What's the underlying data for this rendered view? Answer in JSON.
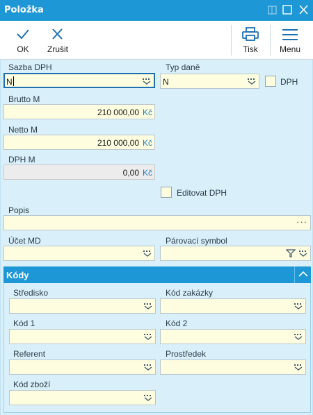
{
  "window": {
    "title": "Položka"
  },
  "toolbar": {
    "ok": "OK",
    "cancel": "Zrušit",
    "print": "Tisk",
    "menu": "Menu"
  },
  "fields": {
    "sazba_dph": {
      "label": "Sazba DPH",
      "value": "N"
    },
    "typ_dane": {
      "label": "Typ daně",
      "value": "N"
    },
    "dph_check": {
      "label": "DPH",
      "checked": false
    },
    "brutto": {
      "label": "Brutto M",
      "value": "210 000,00",
      "currency": "Kč"
    },
    "netto": {
      "label": "Netto M",
      "value": "210 000,00",
      "currency": "Kč"
    },
    "dph_m": {
      "label": "DPH M",
      "value": "0,00",
      "currency": "Kč"
    },
    "editovat_dph": {
      "label": "Editovat DPH",
      "checked": false
    },
    "popis": {
      "label": "Popis",
      "value": ""
    },
    "ucet_md": {
      "label": "Účet MD",
      "value": ""
    },
    "parovaci_symbol": {
      "label": "Párovací symbol",
      "value": ""
    }
  },
  "kody": {
    "title": "Kódy",
    "stredisko": {
      "label": "Středisko",
      "value": ""
    },
    "kod_zakazky": {
      "label": "Kód zakázky",
      "value": ""
    },
    "kod1": {
      "label": "Kód 1",
      "value": ""
    },
    "kod2": {
      "label": "Kód 2",
      "value": ""
    },
    "referent": {
      "label": "Referent",
      "value": ""
    },
    "prostredek": {
      "label": "Prostředek",
      "value": ""
    },
    "kod_zbozi": {
      "label": "Kód zboží",
      "value": ""
    }
  },
  "colors": {
    "accent": "#1e97d6",
    "field_bg": "#fefde0",
    "panel_bg": "#d9f0fb",
    "currency": "#1e7fc0"
  }
}
